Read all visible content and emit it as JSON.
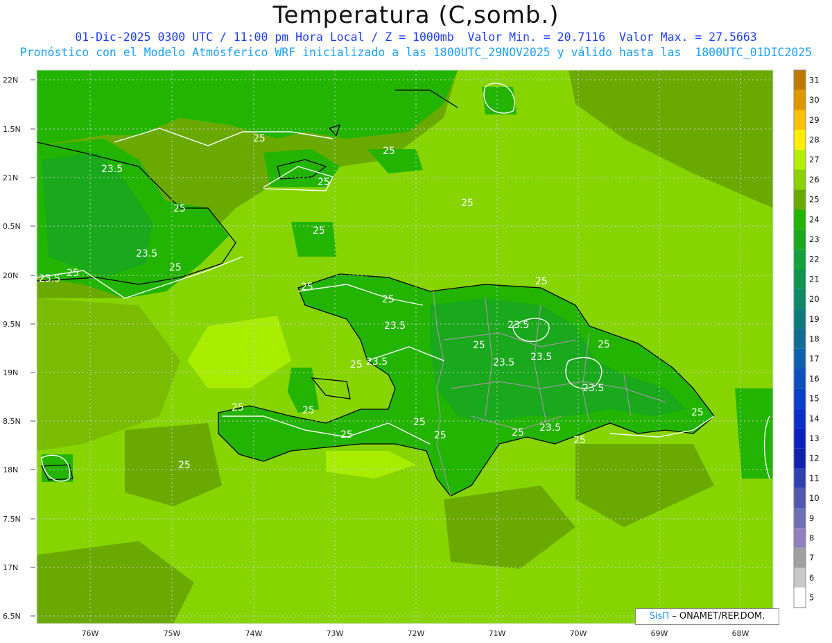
{
  "header": {
    "title": "Temperatura (C,somb.)",
    "subtitle1": "01-Dic-2025 0300 UTC / 11:00 pm Hora Local / Z = 1000mb  Valor Min. = 20.7116  Valor Max. = 27.5663",
    "subtitle2": "Pronóstico con el Modelo Atmósferico WRF inicializado a las 1800UTC_29NOV2025 y válido hasta las  1800UTC_01DIC2025"
  },
  "axes": {
    "lat_labels": [
      "22N",
      "1.5N",
      "21N",
      "0.5N",
      "20N",
      "9.5N",
      "19N",
      "8.5N",
      "18N",
      "7.5N",
      "17N",
      "6.5N"
    ],
    "lon_labels": [
      "76W",
      "75W",
      "74W",
      "73W",
      "72W",
      "71W",
      "70W",
      "69W",
      "68W"
    ]
  },
  "colorbar": {
    "labels": [
      "31",
      "30",
      "29",
      "28",
      "27",
      "26",
      "25",
      "24",
      "23",
      "22",
      "21",
      "20",
      "19",
      "18",
      "17",
      "16",
      "15",
      "14",
      "13",
      "12",
      "11",
      "10",
      "9",
      "8",
      "7",
      "6",
      "5"
    ],
    "colors": [
      "#c07a00",
      "#e09800",
      "#ffc000",
      "#ffee00",
      "#b4f000",
      "#8cd200",
      "#6aaa00",
      "#22b400",
      "#1aa81c",
      "#14a03a",
      "#109450",
      "#10886a",
      "#107a80",
      "#106e96",
      "#1060b0",
      "#0c50c0",
      "#0a40c8",
      "#0a30c8",
      "#0a20c0",
      "#1020b0",
      "#3040b0",
      "#5058b0",
      "#7070b8",
      "#9080c0",
      "#a0a0a0",
      "#c8c8c8",
      "#ffffff"
    ]
  },
  "contour_labels": [
    "25",
    "23.5"
  ],
  "colors": {
    "base": "#86d400",
    "warm": "#a8ec00",
    "mid": "#6ab400",
    "cool": "#22b400",
    "cooler": "#18a828",
    "coast": "#000000",
    "border": "#9a9a9a"
  },
  "credit": {
    "brand": "SisΠ",
    "text": " – ONAMET/REP.DOM."
  }
}
